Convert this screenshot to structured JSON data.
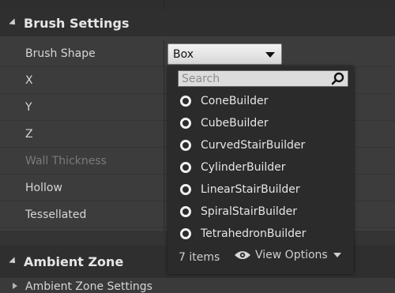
{
  "brush_settings": {
    "header": "Brush Settings",
    "rows": [
      {
        "name": "Brush Shape",
        "disabled": false
      },
      {
        "name": "X",
        "disabled": false
      },
      {
        "name": "Y",
        "disabled": false
      },
      {
        "name": "Z",
        "disabled": false
      },
      {
        "name": "Wall Thickness",
        "disabled": true
      },
      {
        "name": "Hollow",
        "disabled": false
      },
      {
        "name": "Tessellated",
        "disabled": false
      }
    ],
    "brush_shape_value": "Box"
  },
  "dropdown": {
    "search_placeholder": "Search",
    "items": [
      "ConeBuilder",
      "CubeBuilder",
      "CurvedStairBuilder",
      "CylinderBuilder",
      "LinearStairBuilder",
      "SpiralStairBuilder",
      "TetrahedronBuilder"
    ],
    "item_count": "7 items",
    "view_options": "View Options"
  },
  "ambient_zone": {
    "header": "Ambient Zone",
    "sub_item": "Ambient Zone Settings"
  }
}
